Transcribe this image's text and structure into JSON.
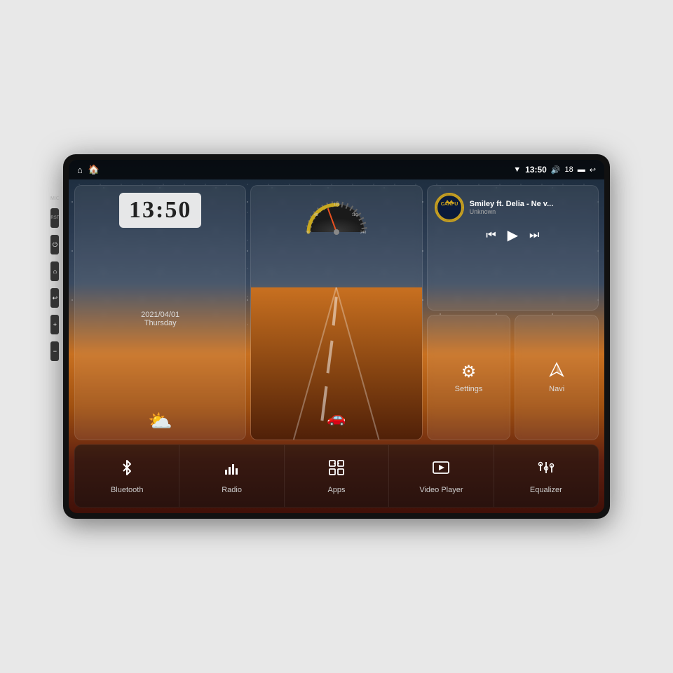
{
  "device": {
    "title": "Car Head Unit Display"
  },
  "status_bar": {
    "left_icons": [
      "home",
      "house"
    ],
    "mic_label": "MIC",
    "rst_label": "RST",
    "time": "13:50",
    "volume": "18",
    "wifi_icon": "wifi",
    "volume_icon": "volume",
    "battery_icon": "battery",
    "back_icon": "back"
  },
  "clock": {
    "time": "13:50",
    "date": "2021/04/01",
    "day": "Thursday",
    "weather": "☁️"
  },
  "music": {
    "logo_text": "CARFU",
    "song_title": "Smiley ft. Delia - Ne v...",
    "artist": "Unknown",
    "prev_icon": "⏮",
    "play_icon": "▶",
    "next_icon": "⏭"
  },
  "settings": {
    "label": "Settings",
    "icon": "⚙"
  },
  "navi": {
    "label": "Navi",
    "icon": "◭"
  },
  "bottom_buttons": [
    {
      "id": "bluetooth",
      "label": "Bluetooth",
      "icon": "bluetooth"
    },
    {
      "id": "radio",
      "label": "Radio",
      "icon": "radio"
    },
    {
      "id": "apps",
      "label": "Apps",
      "icon": "apps"
    },
    {
      "id": "video",
      "label": "Video Player",
      "icon": "video"
    },
    {
      "id": "equalizer",
      "label": "Equalizer",
      "icon": "equalizer"
    }
  ],
  "side_buttons": [
    {
      "id": "power",
      "icon": "⏻"
    },
    {
      "id": "home",
      "icon": "⌂"
    },
    {
      "id": "back",
      "icon": "↩"
    },
    {
      "id": "vol-up",
      "icon": "+"
    },
    {
      "id": "vol-down",
      "icon": "−"
    }
  ]
}
